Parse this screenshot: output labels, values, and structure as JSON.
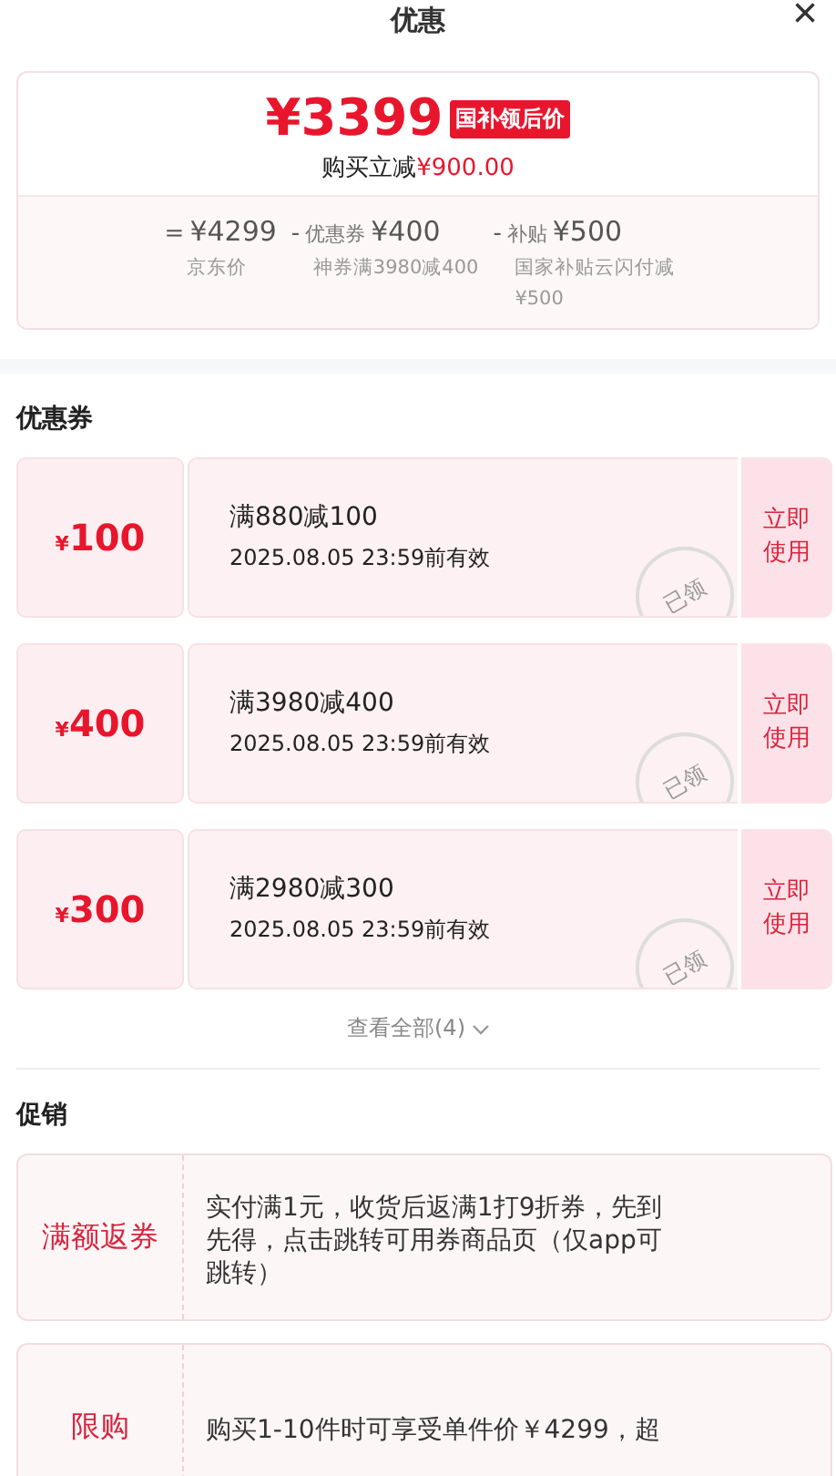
{
  "header": {
    "title": "优惠",
    "close": "×"
  },
  "price": {
    "amount": "¥3399",
    "tag": "国补领后价",
    "saving_label": "购买立减",
    "saving_value": "¥900.00",
    "breakdown": [
      {
        "op": "=",
        "value": "¥4299",
        "note": "京东价"
      },
      {
        "op": "-",
        "label": "优惠券",
        "value": "¥400",
        "note": "神券满3980减400"
      },
      {
        "op": "-",
        "label": "补贴",
        "value": "¥500",
        "note": "国家补贴云闪付减¥500"
      }
    ]
  },
  "coupons_title": "优惠券",
  "coupons": [
    {
      "amount": "100",
      "condition": "满880减100",
      "validity": "2025.08.05 23:59前有效",
      "action": "立即使用",
      "stamp": "已领"
    },
    {
      "amount": "400",
      "condition": "满3980减400",
      "validity": "2025.08.05 23:59前有效",
      "action": "立即使用",
      "stamp": "已领"
    },
    {
      "amount": "300",
      "condition": "满2980减300",
      "validity": "2025.08.05 23:59前有效",
      "action": "立即使用",
      "stamp": "已领"
    }
  ],
  "currency": "¥",
  "view_all": "查看全部(4)",
  "promotions_title": "促销",
  "promotions": [
    {
      "type": "满额返券",
      "text": "实付满1元，收货后返满1打9折券，先到先得，点击跳转可用券商品页（仅app可跳转）"
    },
    {
      "type": "限购",
      "text": "购买1-10件时可享受单件价￥4299，超"
    }
  ]
}
